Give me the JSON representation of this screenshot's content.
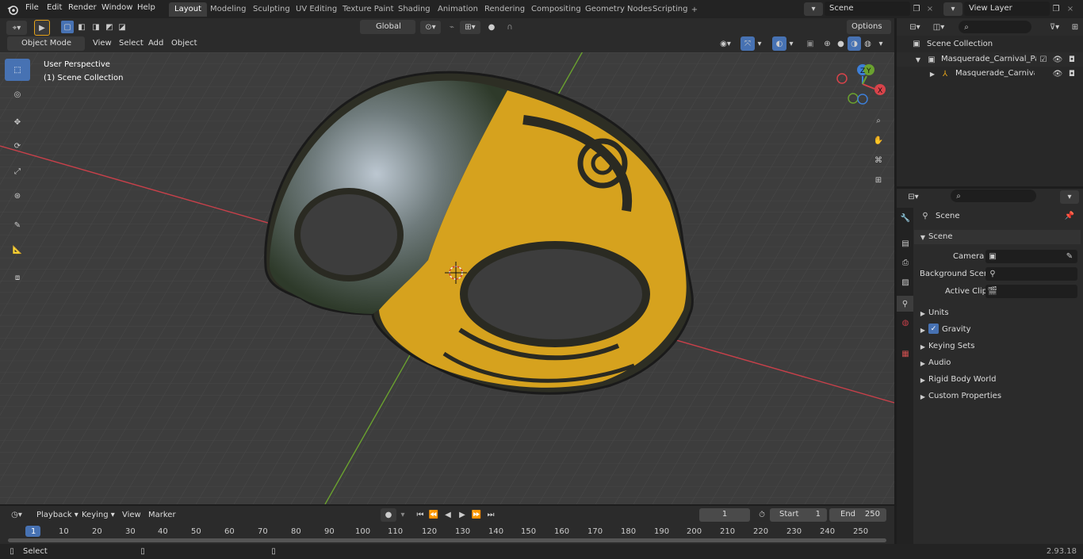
{
  "topbar": {
    "menus": [
      "File",
      "Edit",
      "Render",
      "Window",
      "Help"
    ],
    "workspaces": [
      "Layout",
      "Modeling",
      "Sculpting",
      "UV Editing",
      "Texture Paint",
      "Shading",
      "Animation",
      "Rendering",
      "Compositing",
      "Geometry Nodes",
      "Scripting"
    ],
    "active_workspace": "Layout",
    "scene_name": "Scene",
    "view_layer": "View Layer"
  },
  "viewport_header": {
    "mode": "Object Mode",
    "menus": [
      "View",
      "Select",
      "Add",
      "Object"
    ],
    "transform_orientation": "Global",
    "options_label": "Options"
  },
  "viewport": {
    "perspective": "User Perspective",
    "collection": "(1) Scene Collection",
    "gizmo_axes": {
      "x": "X",
      "y": "Y",
      "z": "Z"
    },
    "colors": {
      "x_axis": "#c8404a",
      "y_axis": "#6aa12f",
      "mask_yellow": "#d6a21e",
      "grid_bg": "#3d3d3d"
    }
  },
  "outliner": {
    "root": "Scene Collection",
    "items": [
      {
        "label": "Masquerade_Carnival_Party_I"
      },
      {
        "label": "Masquerade_Carnival_Pa"
      }
    ]
  },
  "properties": {
    "title": "Scene",
    "section": "Scene",
    "fields": [
      {
        "label": "Camera"
      },
      {
        "label": "Background Scene"
      },
      {
        "label": "Active Clip"
      }
    ],
    "panels": [
      "Units",
      "Gravity",
      "Keying Sets",
      "Audio",
      "Rigid Body World",
      "Custom Properties"
    ],
    "gravity_checked": true
  },
  "timeline": {
    "menus": [
      "Playback",
      "Keying",
      "View",
      "Marker"
    ],
    "current_frame": "1",
    "start_label": "Start",
    "start": "1",
    "end_label": "End",
    "end": "250",
    "ticks": [
      "1",
      "10",
      "20",
      "30",
      "40",
      "50",
      "60",
      "70",
      "80",
      "90",
      "100",
      "110",
      "120",
      "130",
      "140",
      "150",
      "160",
      "170",
      "180",
      "190",
      "200",
      "210",
      "220",
      "230",
      "240",
      "250"
    ]
  },
  "statusbar": {
    "left": "Select",
    "version": "2.93.18"
  }
}
